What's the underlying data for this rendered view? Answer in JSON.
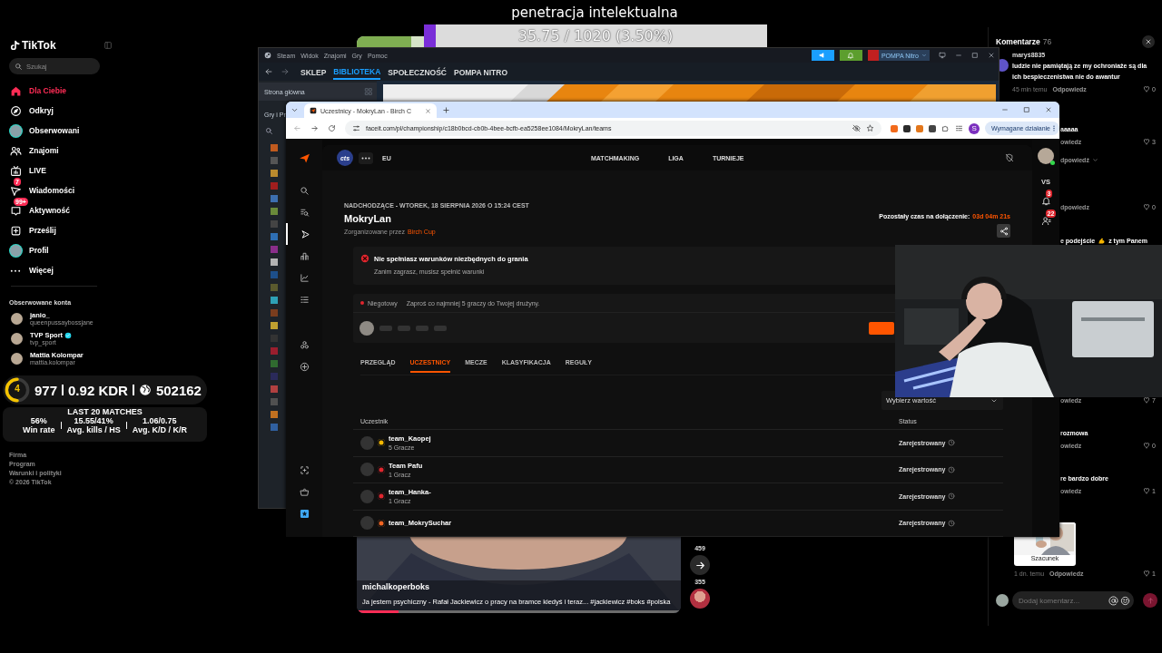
{
  "stream_overlay": {
    "title": "penetracja intelektualna",
    "progress": {
      "level": 0.035,
      "reading": "35.75 / 1020 (3.50%)"
    }
  },
  "tiktok": {
    "sidebar": {
      "logo": "TikTok",
      "search": {
        "placeholder": "Szukaj"
      },
      "nav": [
        {
          "label": "Dla Ciebie",
          "selected": true
        },
        {
          "label": "Odkryj",
          "selected": false
        },
        {
          "label": "Obserwowani",
          "selected": false
        },
        {
          "label": "Znajomi",
          "selected": false
        },
        {
          "label": "LIVE",
          "selected": false
        },
        {
          "label": "Wiadomości",
          "badge": "7",
          "selected": false
        },
        {
          "label": "Aktywność",
          "badge": "99+",
          "selected": false
        },
        {
          "label": "Prześlij",
          "selected": false
        },
        {
          "label": "Profil",
          "selected": false
        },
        {
          "label": "Więcej",
          "selected": false
        }
      ],
      "followed_title": "Obserwowane konta",
      "followed": [
        {
          "name": "janio_",
          "handle": "queenpussaybossjane",
          "verified": false
        },
        {
          "name": "TVP Sport",
          "handle": "tvp_sport",
          "verified": true
        },
        {
          "name": "Mattia Kolompar",
          "handle": "mattia.kolompar",
          "verified": false
        }
      ],
      "footer": [
        "Firma",
        "Program",
        "Warunki i polityki",
        "© 2026 TikTok"
      ]
    },
    "video": {
      "author": "michalkoperboks",
      "caption": "Ja jestem psychiczny - Rafał Jackiewicz o pracy na bramce kiedyś i teraz... #jackiewicz #boks #polska",
      "level": 0.13,
      "actions": [
        {
          "kind": "count",
          "count": "459"
        },
        {
          "kind": "share",
          "count": "355"
        },
        {
          "kind": "avatar"
        }
      ]
    },
    "comments": {
      "title": "Komentarze",
      "count": "76",
      "first": {
        "user": "maryś8835",
        "text": "ludzie nie pamiętają ze my ochroniaże są dla ich bespieczenistwa nie do awantur",
        "time": "45 min temu",
        "reply": "Odpowiedz",
        "likes": "0"
      },
      "upper": [
        {
          "kind": "text",
          "text": "aaaaa"
        },
        {
          "kind": "meta",
          "reply": "owiedz",
          "likes": "3"
        },
        {
          "kind": "replies",
          "text": "dpowiedź"
        },
        {
          "kind": "meta",
          "reply": "dpowiedz",
          "likes": "0"
        },
        {
          "kind": "emoji",
          "before": "e podejście",
          "after": "z tym Panem"
        }
      ],
      "lower": [
        {
          "kind": "meta",
          "reply": "owiedz",
          "likes": "7"
        },
        {
          "kind": "text",
          "text": "rozmowa"
        },
        {
          "kind": "meta",
          "reply": "owiedz",
          "likes": "0"
        },
        {
          "kind": "text",
          "text": "re bardzo dobre"
        },
        {
          "kind": "meta",
          "reply": "owiedz",
          "likes": "1"
        }
      ],
      "sticker": {
        "caption": "Szacunek",
        "time": "1 dn. temu",
        "reply": "Odpowiedz",
        "likes": "1"
      },
      "input": {
        "placeholder": "Dodaj komentarz..."
      }
    }
  },
  "stats_overlay": {
    "level": "4",
    "elo": "977",
    "kdr": "0.92 KDR",
    "rank": "502162",
    "title": "LAST 20 MATCHES",
    "columns": [
      {
        "value": "56%",
        "label": "Win rate"
      },
      {
        "value": "15.55/41%",
        "label": "Avg. kills / HS"
      },
      {
        "value": "1.06/0.75",
        "label": "Avg. K/D / K/R"
      }
    ]
  },
  "steam": {
    "menu": [
      "Steam",
      "Widok",
      "Znajomi",
      "Gry",
      "Pomoc"
    ],
    "account": "POMPA Nitro",
    "nav": [
      {
        "label": "SKLEP",
        "selected": false
      },
      {
        "label": "BIBLIOTEKA",
        "selected": true
      },
      {
        "label": "SPOŁECZNOŚĆ",
        "selected": false
      },
      {
        "label": "POMPA NITRO",
        "selected": false
      }
    ],
    "home": "Strona główna",
    "section": "Gry i Pr"
  },
  "browser": {
    "tab": {
      "title": "Uczestnicy - MokryLan - Birch C",
      "selected": true
    },
    "url": "faceit.com/pl/championship/c18b0bcd-cb0b-4bee-bcfb-ea5258ee1084/MokryLan/teams",
    "profile": "S",
    "action": "Wymagane działanie"
  },
  "faceit": {
    "club": "cts",
    "region": "EU",
    "top_nav": [
      "MATCHMAKING",
      "LIGA",
      "TURNIEJE"
    ],
    "rail": [
      {
        "selected": false
      },
      {
        "selected": false
      },
      {
        "selected": true
      },
      {
        "selected": false
      },
      {
        "selected": false
      },
      {
        "selected": false
      },
      {
        "selected": false
      },
      {
        "selected": false
      },
      {
        "selected": false
      },
      {
        "selected": false
      },
      {
        "selected": false
      }
    ],
    "right_rail": {
      "vs": "VS",
      "notifications": "3",
      "requests": "22"
    },
    "event": {
      "status": "NADCHODZĄCE - WTOREK, 18 SIERPNIA 2026 O 15:24 CEST",
      "name": "MokryLan",
      "organizer_label": "Zorganizowane przez",
      "organizer": "Birch Cup",
      "join_label": "Pozostały czas na dołączenie:",
      "join_time": "03d 04m 21s"
    },
    "requirement": {
      "title": "Nie spełniasz warunków niezbędnych do grania",
      "text": "Zanim zagrasz, musisz spełnić warunki"
    },
    "ready": {
      "status": "Niegotowy",
      "text": "Zaproś co najmniej 5 graczy do Twojej drużyny."
    },
    "tabs": [
      {
        "label": "PRZEGLĄD",
        "selected": false
      },
      {
        "label": "UCZESTNICY",
        "selected": true
      },
      {
        "label": "MECZE",
        "selected": false
      },
      {
        "label": "KLASYFIKACJA",
        "selected": false
      },
      {
        "label": "REGUŁY",
        "selected": false
      }
    ],
    "filter": {
      "placeholder": "Wybierz wartość"
    },
    "table": {
      "columns": [
        "Uczestnik",
        "Status"
      ],
      "rows": [
        {
          "name": "team_Kaopej",
          "players": "5 Gracze",
          "status": "Zarejestrowany",
          "color": "#f5b700"
        },
        {
          "name": "Team Pafu",
          "players": "1 Gracz",
          "status": "Zarejestrowany",
          "color": "#e0262e"
        },
        {
          "name": "team_Hanka-",
          "players": "1 Gracz",
          "status": "Zarejestrowany",
          "color": "#e0262e"
        },
        {
          "name": "team_MokrySuchar",
          "status": "Zarejestrowany",
          "color": "#f26522"
        }
      ]
    }
  }
}
